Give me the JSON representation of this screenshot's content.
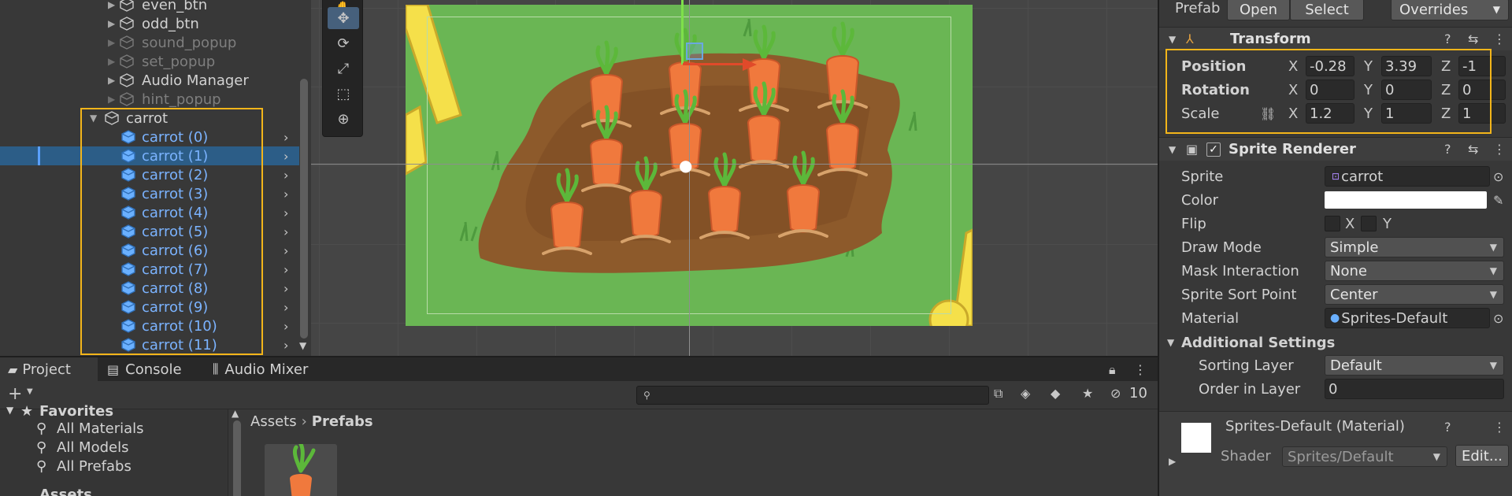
{
  "hierarchy": {
    "items": [
      {
        "label": "even_btn",
        "state": "normal"
      },
      {
        "label": "odd_btn",
        "state": "normal"
      },
      {
        "label": "sound_popup",
        "state": "dim"
      },
      {
        "label": "set_popup",
        "state": "dim"
      },
      {
        "label": "Audio Manager",
        "state": "normal"
      },
      {
        "label": "hint_popup",
        "state": "dim"
      }
    ],
    "parent": "carrot",
    "children": [
      "carrot (0)",
      "carrot (1)",
      "carrot (2)",
      "carrot (3)",
      "carrot (4)",
      "carrot (5)",
      "carrot (6)",
      "carrot (7)",
      "carrot (8)",
      "carrot (9)",
      "carrot (10)",
      "carrot (11)"
    ],
    "selected_index": 1
  },
  "inspector": {
    "prefab_label": "Prefab",
    "open_label": "Open",
    "select_label": "Select",
    "overrides_label": "Overrides",
    "transform": {
      "title": "Transform",
      "position_label": "Position",
      "rotation_label": "Rotation",
      "scale_label": "Scale",
      "position": {
        "x": "-0.28",
        "y": "3.39",
        "z": "-1"
      },
      "rotation": {
        "x": "0",
        "y": "0",
        "z": "0"
      },
      "scale": {
        "x": "1.2",
        "y": "1",
        "z": "1"
      }
    },
    "sprite_renderer": {
      "title": "Sprite Renderer",
      "sprite_label": "Sprite",
      "sprite_value": "carrot",
      "color_label": "Color",
      "flip_label": "Flip",
      "flip_x": "X",
      "flip_y": "Y",
      "draw_mode_label": "Draw Mode",
      "draw_mode_value": "Simple",
      "mask_label": "Mask Interaction",
      "mask_value": "None",
      "sort_point_label": "Sprite Sort Point",
      "sort_point_value": "Center",
      "material_label": "Material",
      "material_value": "Sprites-Default",
      "additional_label": "Additional Settings",
      "sorting_layer_label": "Sorting Layer",
      "sorting_layer_value": "Default",
      "order_label": "Order in Layer",
      "order_value": "0"
    },
    "material": {
      "title": "Sprites-Default (Material)",
      "shader_label": "Shader",
      "shader_value": "Sprites/Default",
      "edit_label": "Edit..."
    }
  },
  "project": {
    "tabs": [
      "Project",
      "Console",
      "Audio Mixer"
    ],
    "hidden_count": "10",
    "favorites_label": "Favorites",
    "favorites": [
      "All Materials",
      "All Models",
      "All Prefabs"
    ],
    "assets_label": "Assets",
    "breadcrumb": {
      "root": "Assets",
      "current": "Prefabs"
    }
  },
  "colors": {
    "selection": "#2c5d87",
    "highlight": "#f3b51a",
    "prefab_blue": "#7bb3ff",
    "grass": "#6ab654",
    "soil": "#8d5a2b",
    "carrot": "#f0793d"
  }
}
